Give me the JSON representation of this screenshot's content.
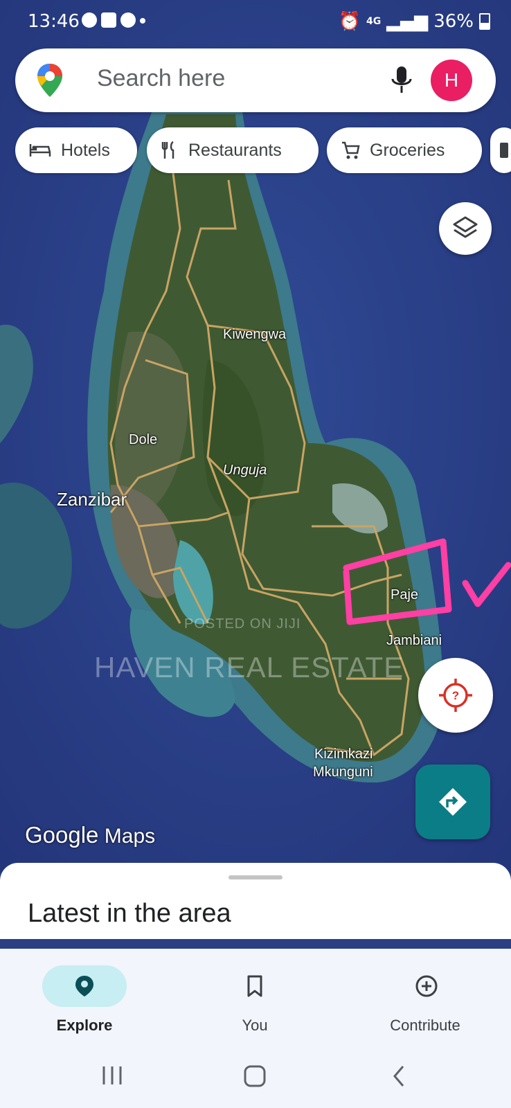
{
  "status_bar": {
    "time": "13:46",
    "network": "4G",
    "battery": "36%"
  },
  "search": {
    "placeholder": "Search here",
    "avatar_initial": "H"
  },
  "chips": [
    {
      "label": "Hotels",
      "icon": "hotel-bed-icon"
    },
    {
      "label": "Restaurants",
      "icon": "fork-knife-icon"
    },
    {
      "label": "Groceries",
      "icon": "shopping-cart-icon"
    }
  ],
  "map": {
    "places": [
      {
        "label": "Kiwengwa"
      },
      {
        "label": "Dole"
      },
      {
        "label": "Unguja"
      },
      {
        "label": "Zanzibar"
      },
      {
        "label": "Paje"
      },
      {
        "label": "Jambiani"
      },
      {
        "label": "Kizimkazi"
      },
      {
        "label": "Mkunguni"
      }
    ],
    "attribution": {
      "brand": "Google",
      "product": "Maps"
    },
    "watermark_line1": "POSTED ON JIJI",
    "watermark_line2": "HAVEN REAL ESTATE",
    "annotation_color": "#ff3fa4"
  },
  "sheet": {
    "title": "Latest in the area"
  },
  "bottom_nav": [
    {
      "label": "Explore",
      "icon": "explore-pin-icon",
      "active": true
    },
    {
      "label": "You",
      "icon": "bookmark-icon",
      "active": false
    },
    {
      "label": "Contribute",
      "icon": "add-circle-icon",
      "active": false
    }
  ],
  "colors": {
    "accent": "#0b7d86",
    "avatar": "#e91e63",
    "active_nav": "#c7eef2"
  }
}
